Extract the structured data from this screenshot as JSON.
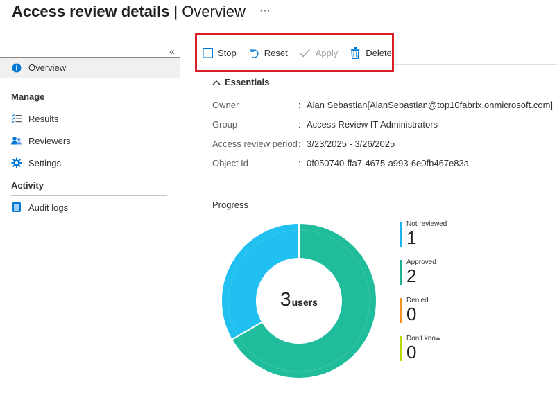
{
  "header": {
    "title": "Access review details",
    "separator": "|",
    "subtitle": "Overview",
    "more": "···"
  },
  "sidebar": {
    "collapse_glyph": "«",
    "items": [
      {
        "label": "Overview"
      }
    ],
    "sections": [
      {
        "title": "Manage",
        "items": [
          {
            "label": "Results"
          },
          {
            "label": "Reviewers"
          },
          {
            "label": "Settings"
          }
        ]
      },
      {
        "title": "Activity",
        "items": [
          {
            "label": "Audit logs"
          }
        ]
      }
    ]
  },
  "toolbar": {
    "stop_label": "Stop",
    "reset_label": "Reset",
    "apply_label": "Apply",
    "delete_label": "Delete"
  },
  "essentials": {
    "label": "Essentials",
    "rows": [
      {
        "label": "Owner",
        "value": "Alan Sebastian[AlanSebastian@top10fabrix.onmicrosoft.com]"
      },
      {
        "label": "Group",
        "value": "Access Review IT Administrators"
      },
      {
        "label": "Access review period",
        "value": "3/23/2025 - 3/26/2025"
      },
      {
        "label": "Object Id",
        "value": "0f050740-ffa7-4675-a993-6e0fb467e83a"
      }
    ],
    "colon": ":"
  },
  "progress": {
    "title": "Progress",
    "total": "3",
    "unit": "users",
    "legend": [
      {
        "label": "Not reviewed",
        "value": "1",
        "color": "#1ab4f0"
      },
      {
        "label": "Approved",
        "value": "2",
        "color": "#1ab394"
      },
      {
        "label": "Denied",
        "value": "0",
        "color": "#f7931e"
      },
      {
        "label": "Don't know",
        "value": "0",
        "color": "#bad80a"
      }
    ]
  },
  "chart_data": {
    "type": "pie",
    "categories": [
      "Not reviewed",
      "Approved",
      "Denied",
      "Don't know"
    ],
    "values": [
      1,
      2,
      0,
      0
    ],
    "colors": [
      "#20c0f0",
      "#20bd9c",
      "#f7931e",
      "#bad80a"
    ]
  },
  "colors": {
    "accent": "#0078d4",
    "highlight_border": "#d81f26"
  }
}
